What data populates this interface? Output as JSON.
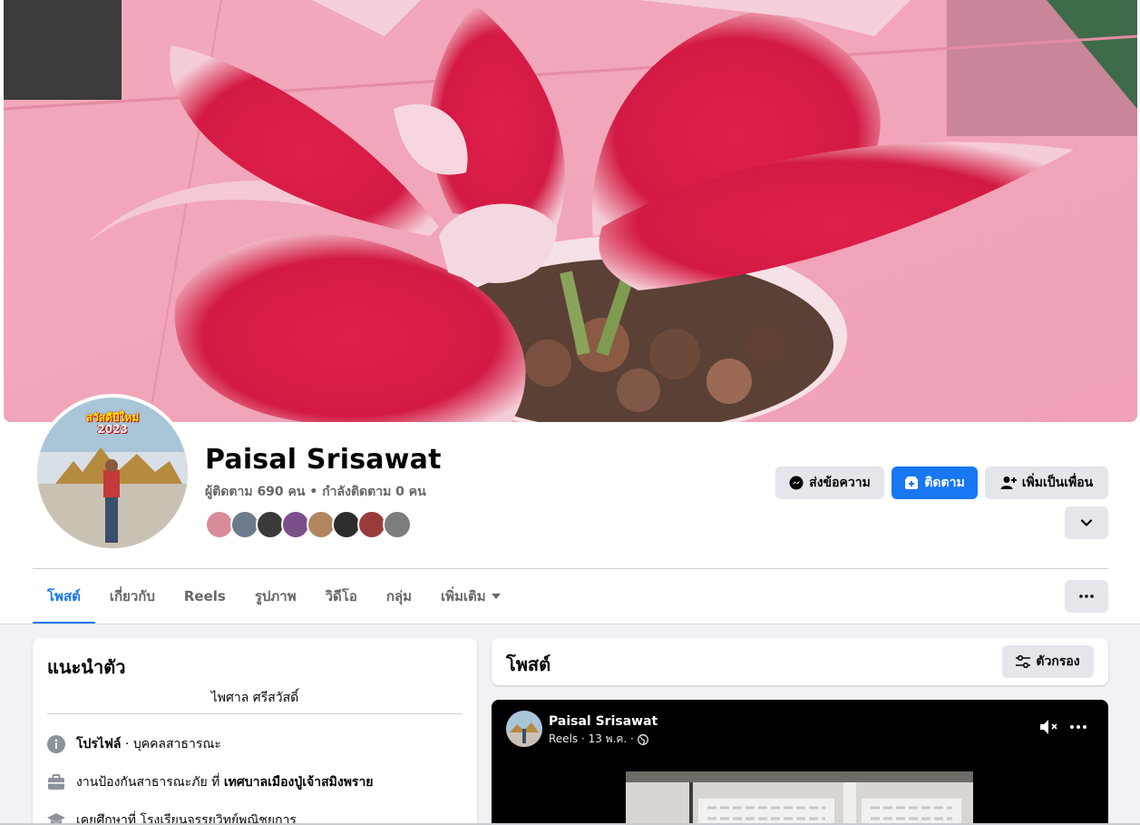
{
  "profile": {
    "name": "Paisal Srisawat",
    "followers_text": "ผู้ติดตาม 690 คน",
    "following_text": "กำลังติดตาม 0 คน",
    "separator": "•",
    "avatar_text_line1": "สวัสดีปีใหม่",
    "avatar_text_line2": "2023"
  },
  "actions": {
    "message_label": "ส่งข้อความ",
    "follow_label": "ติดตาม",
    "add_friend_label": "เพิ่มเป็นเพื่อน"
  },
  "tabs": [
    {
      "label": "โพสต์",
      "active": true
    },
    {
      "label": "เกี่ยวกับ",
      "active": false
    },
    {
      "label": "Reels",
      "active": false
    },
    {
      "label": "รูปภาพ",
      "active": false
    },
    {
      "label": "วิดีโอ",
      "active": false
    },
    {
      "label": "กลุ่ม",
      "active": false
    },
    {
      "label": "เพิ่มเติม",
      "active": false
    }
  ],
  "intro": {
    "title": "แนะนำตัว",
    "bio": "ไพศาล ศรีสวัสดิ์",
    "profile_label": "โปรไฟล์",
    "profile_type": " · บุคคลสาธารณะ",
    "work_prefix": "งานป้องกันสาธารณะภัย ที่ ",
    "work_place": "เทศบาลเมืองปู่เจ้าสมิงพราย",
    "education_text": "เคยศึกษาที่ โรงเรียนจรรยวิทย์พณิชยการ"
  },
  "posts": {
    "title": "โพสต์",
    "filter_label": "ตัวกรอง"
  },
  "reel_post": {
    "author": "Paisal Srisawat",
    "meta": "Reels · 13 พ.ค. ·"
  },
  "colors": {
    "accent": "#1877f2",
    "secondary_text": "#65676b",
    "page_bg": "#f0f2f5"
  },
  "icons": [
    "messenger-icon",
    "follow-icon",
    "add-friend-icon",
    "chevron-down-icon",
    "more-icon",
    "info-icon",
    "briefcase-icon",
    "graduation-cap-icon",
    "filter-icon",
    "mute-icon",
    "globe-icon",
    "caret-down-icon"
  ]
}
